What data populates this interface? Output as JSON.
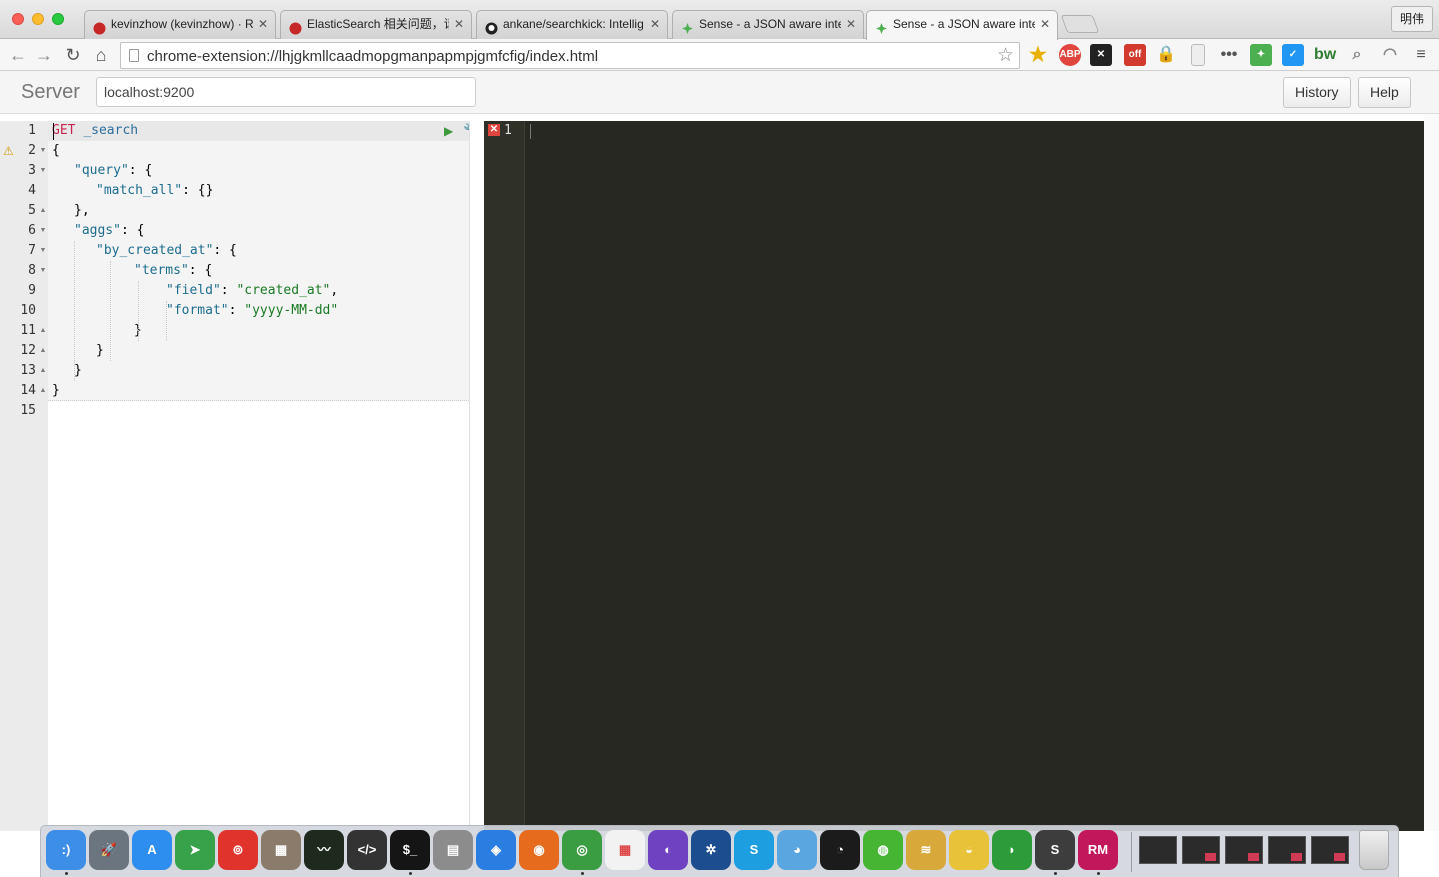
{
  "browser": {
    "tabs": [
      {
        "title": "kevinzhow (kevinzhow) · Ru",
        "favicon": "ruby-red-gem-icon"
      },
      {
        "title": "ElasticSearch 相关问题，请",
        "favicon": "ruby-red-gem-icon"
      },
      {
        "title": "ankane/searchkick: Intellig",
        "favicon": "github-icon"
      },
      {
        "title": "Sense - a JSON aware inte",
        "favicon": "sense-green-icon"
      },
      {
        "title": "Sense - a JSON aware inte",
        "favicon": "sense-green-icon",
        "active": true
      }
    ],
    "profile_name": "明伟",
    "url": "chrome-extension://lhjgkmllcaadmopgmanpapmpjgmfcfig/index.html",
    "extensions": [
      {
        "name": "abp-icon",
        "label": "ABP",
        "color": "#e0463e"
      },
      {
        "name": "x-icon",
        "label": "✕",
        "color": "#222222"
      },
      {
        "name": "off-icon",
        "label": "off",
        "color": "#d13a2c"
      },
      {
        "name": "lock-icon",
        "label": "🔒",
        "color": "#e8b100"
      },
      {
        "name": "doc-icon",
        "label": "",
        "color": "#cccccc"
      },
      {
        "name": "dots-icon",
        "label": "•••",
        "color": "#555555"
      },
      {
        "name": "sense-icon",
        "label": "✦",
        "color": "#4caf50"
      },
      {
        "name": "pocket-icon",
        "label": "✓",
        "color": "#2196f3"
      },
      {
        "name": "bw-icon",
        "label": "bw",
        "color": "#2e7d32"
      },
      {
        "name": "search-icon",
        "label": "⌕",
        "color": "#888888"
      },
      {
        "name": "cast-icon",
        "label": "◠",
        "color": "#888888"
      },
      {
        "name": "menu-icon",
        "label": "≡",
        "color": "#555555"
      }
    ]
  },
  "sense": {
    "server_label": "Server",
    "server_value": "localhost:9200",
    "history_label": "History",
    "help_label": "Help"
  },
  "editor": {
    "line_numbers": [
      "1",
      "2",
      "3",
      "4",
      "5",
      "6",
      "7",
      "8",
      "9",
      "10",
      "11",
      "12",
      "13",
      "14",
      "15"
    ],
    "method": "GET",
    "url": "_search",
    "lines": [
      {
        "n": 2,
        "indent": 0,
        "tokens": [
          [
            "p",
            "{"
          ]
        ]
      },
      {
        "n": 3,
        "indent": 1,
        "tokens": [
          [
            "k",
            "\"query\""
          ],
          [
            "p",
            ": {"
          ]
        ]
      },
      {
        "n": 4,
        "indent": 2,
        "tokens": [
          [
            "k",
            "\"match_all\""
          ],
          [
            "p",
            ": {}"
          ]
        ]
      },
      {
        "n": 5,
        "indent": 1,
        "tokens": [
          [
            "p",
            "},"
          ]
        ]
      },
      {
        "n": 6,
        "indent": 1,
        "tokens": [
          [
            "k",
            "\"aggs\""
          ],
          [
            "p",
            ": {"
          ]
        ]
      },
      {
        "n": 7,
        "indent": 2,
        "tokens": [
          [
            "k",
            "\"by_created_at\""
          ],
          [
            "p",
            ": {"
          ]
        ]
      },
      {
        "n": 8,
        "indent": 3,
        "tokens": [
          [
            "k",
            "\"terms\""
          ],
          [
            "p",
            ": {"
          ]
        ]
      },
      {
        "n": 9,
        "indent": 4,
        "tokens": [
          [
            "k",
            "\"field\""
          ],
          [
            "p",
            ": "
          ],
          [
            "s",
            "\"created_at\""
          ],
          [
            "p",
            ","
          ]
        ]
      },
      {
        "n": 10,
        "indent": 4,
        "tokens": [
          [
            "k",
            "\"format\""
          ],
          [
            "p",
            ": "
          ],
          [
            "s",
            "\"yyyy-MM-dd\""
          ]
        ]
      },
      {
        "n": 11,
        "indent": 3,
        "tokens": [
          [
            "p",
            "}"
          ]
        ]
      },
      {
        "n": 12,
        "indent": 2,
        "tokens": [
          [
            "p",
            "}"
          ]
        ]
      },
      {
        "n": 13,
        "indent": 1,
        "tokens": [
          [
            "p",
            "}"
          ]
        ]
      },
      {
        "n": 14,
        "indent": 0,
        "tokens": [
          [
            "p",
            "}"
          ]
        ]
      }
    ]
  },
  "output": {
    "line_number": "1"
  },
  "dock": {
    "apps": [
      {
        "name": "finder-icon",
        "color": "#3d8ee6",
        "label": ":)"
      },
      {
        "name": "launchpad-icon",
        "color": "#6b7580",
        "label": "🚀"
      },
      {
        "name": "app-store-icon",
        "color": "#2d8ef0",
        "label": "A"
      },
      {
        "name": "telegram-icon",
        "color": "#37a24a",
        "label": "➤"
      },
      {
        "name": "netease-music-icon",
        "color": "#e0332b",
        "label": "⊚"
      },
      {
        "name": "calculator-icon",
        "color": "#8b7b6a",
        "label": "▦"
      },
      {
        "name": "activity-monitor-icon",
        "color": "#1e2a1e",
        "label": "〰"
      },
      {
        "name": "script-editor-icon",
        "color": "#333333",
        "label": "&lt;/&gt;"
      },
      {
        "name": "terminal-icon",
        "color": "#151515",
        "label": "$_"
      },
      {
        "name": "printer-icon",
        "color": "#8c8c8c",
        "label": "▤"
      },
      {
        "name": "safari-icon",
        "color": "#2a7de1",
        "label": "◈"
      },
      {
        "name": "firefox-icon",
        "color": "#e66b1d",
        "label": "◉"
      },
      {
        "name": "chrome-icon",
        "color": "#3a9d41",
        "label": "◎"
      },
      {
        "name": "launchpad-grid-icon",
        "color": "#f2f2f2",
        "label": "▦"
      },
      {
        "name": "github-desktop-icon",
        "color": "#6f42c1",
        "label": "◐"
      },
      {
        "name": "sourcetree-icon",
        "color": "#1b4d8f",
        "label": "✲"
      },
      {
        "name": "skype-icon",
        "color": "#1d9ee0",
        "label": "S"
      },
      {
        "name": "tweetbot-icon",
        "color": "#5aa6e0",
        "label": "◕"
      },
      {
        "name": "qq-icon",
        "color": "#1b1b1b",
        "label": "◔"
      },
      {
        "name": "wechat-icon",
        "color": "#46b534",
        "label": "◍"
      },
      {
        "name": "sequel-pro-icon",
        "color": "#d8a93a",
        "label": "≋"
      },
      {
        "name": "cashew-icon",
        "color": "#e8c33a",
        "label": "◒"
      },
      {
        "name": "evernote-icon",
        "color": "#2e9b3a",
        "label": "◗"
      },
      {
        "name": "sublime-text-icon",
        "color": "#3d3d3d",
        "label": "S"
      },
      {
        "name": "rubymine-icon",
        "color": "#c2185b",
        "label": "RM"
      }
    ],
    "running": [
      0,
      8,
      12,
      23,
      24
    ]
  }
}
